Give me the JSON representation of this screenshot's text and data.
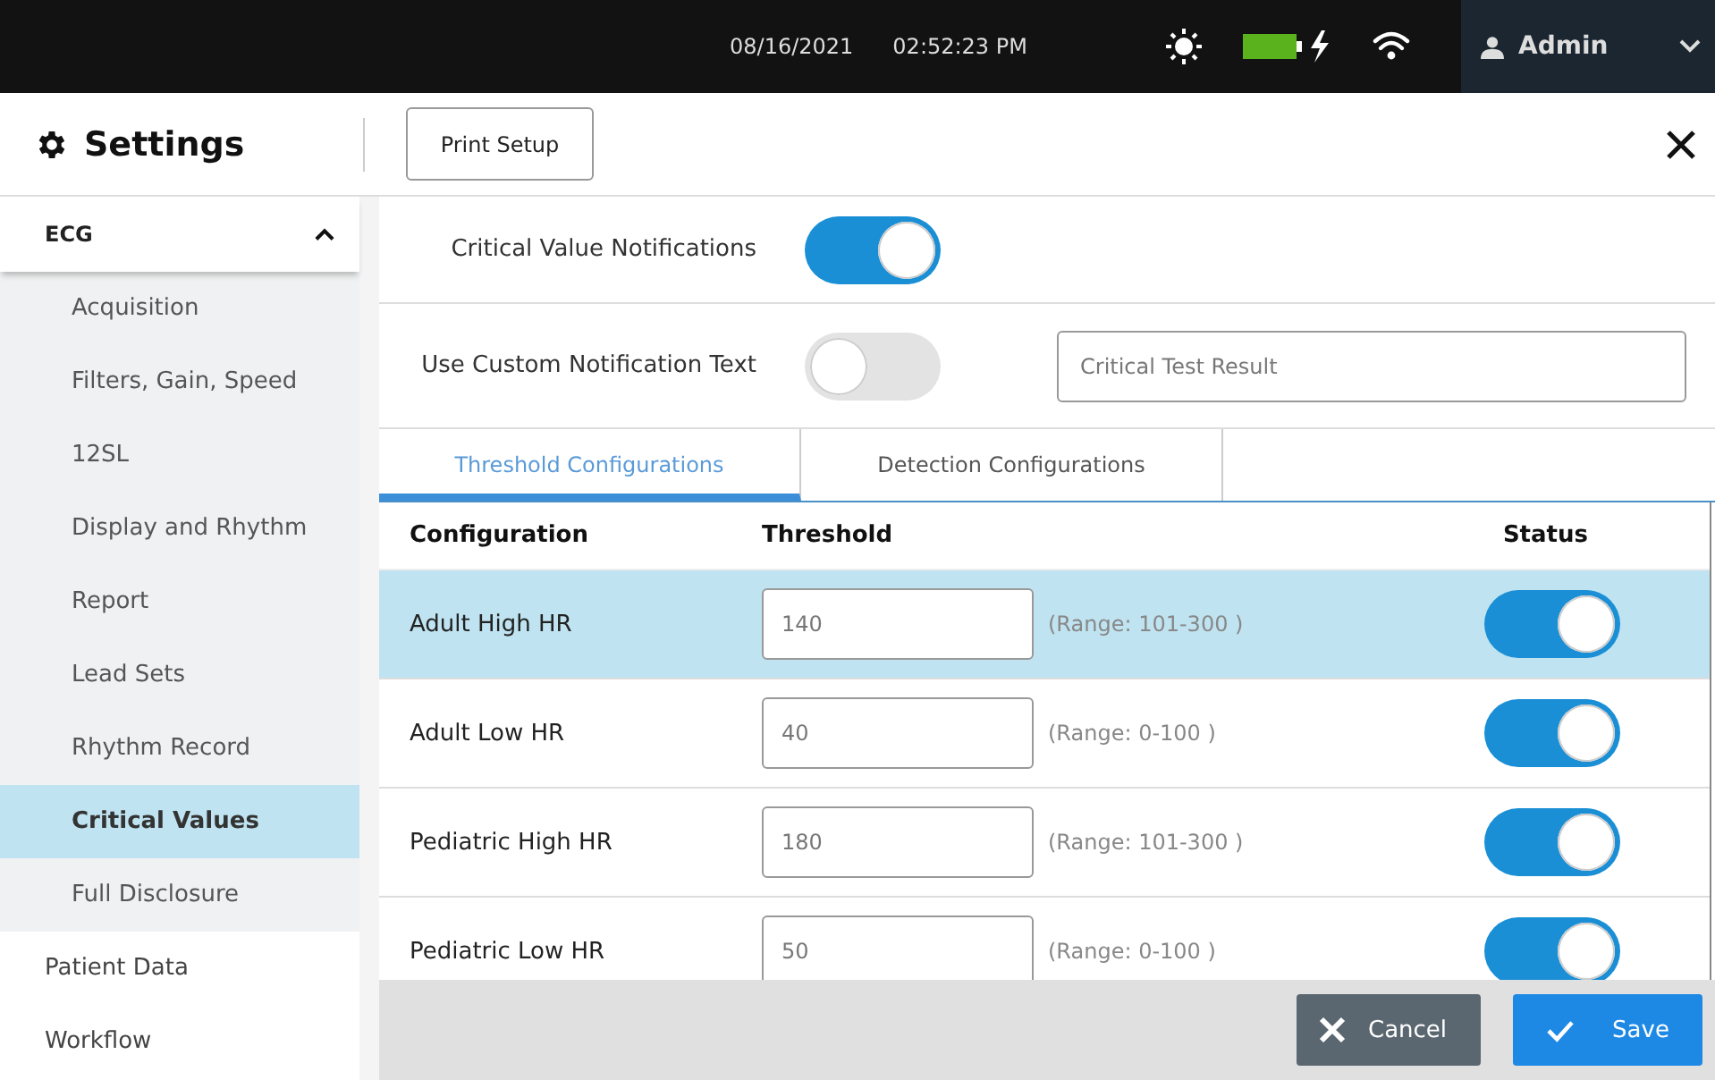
{
  "topbar": {
    "date": "08/16/2021",
    "time": "02:52:23 PM",
    "user": "Admin"
  },
  "header": {
    "title": "Settings",
    "print_button": "Print Setup"
  },
  "sidebar": [
    {
      "label": "ECG",
      "selected": false,
      "expanded": true,
      "children": [
        {
          "label": "Acquisition",
          "selected": false
        },
        {
          "label": "Filters, Gain, Speed",
          "selected": false
        },
        {
          "label": "12SL",
          "selected": false
        },
        {
          "label": "Display and Rhythm",
          "selected": false
        },
        {
          "label": "Report",
          "selected": false
        },
        {
          "label": "Lead Sets",
          "selected": false
        },
        {
          "label": "Rhythm Record",
          "selected": false
        },
        {
          "label": "Critical Values",
          "selected": true
        },
        {
          "label": "Full Disclosure",
          "selected": false
        }
      ]
    },
    {
      "label": "Patient Data",
      "selected": false
    },
    {
      "label": "Workflow",
      "selected": false
    }
  ],
  "settings": [
    {
      "label": "Critical Value Notifications",
      "on": true
    },
    {
      "label": "Use Custom Notification Text",
      "on": false,
      "placeholder": "Critical Test Result"
    }
  ],
  "tabs": [
    {
      "label": "Threshold Configurations",
      "selected": true
    },
    {
      "label": "Detection Configurations",
      "selected": false
    }
  ],
  "table": {
    "columns": [
      "Configuration",
      "Threshold",
      "Status"
    ],
    "rows": [
      {
        "name": "Adult High HR",
        "value": "140",
        "range": "(Range: 101-300 )",
        "on": true,
        "selected": true
      },
      {
        "name": "Adult Low HR",
        "value": "40",
        "range": "(Range: 0-100 )",
        "on": true,
        "selected": false
      },
      {
        "name": "Pediatric High HR",
        "value": "180",
        "range": "(Range: 101-300 )",
        "on": true,
        "selected": false
      },
      {
        "name": "Pediatric Low HR",
        "value": "50",
        "range": "(Range: 0-100 )",
        "on": true,
        "selected": false
      }
    ]
  },
  "footer": [
    {
      "kind": "cancel",
      "label": "Cancel"
    },
    {
      "kind": "save",
      "label": "Save"
    }
  ]
}
